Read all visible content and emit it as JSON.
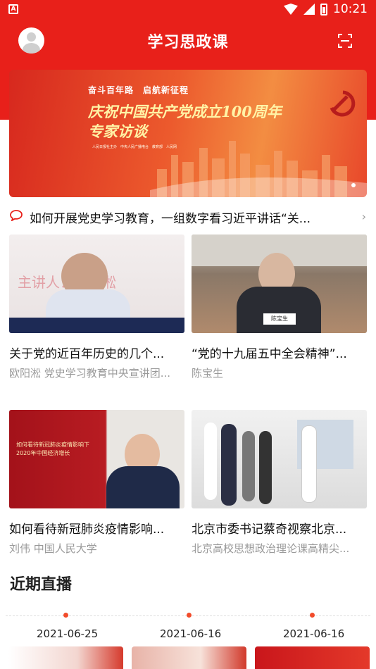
{
  "status": {
    "time": "10:21",
    "app_badge": "A"
  },
  "header": {
    "title": "学习思政课"
  },
  "banner": {
    "subtitle": "奋斗百年路　启航新征程",
    "title_line1": "庆祝中国共产党成立100周年",
    "title_line2": "专家访谈",
    "fine_print": "人民日报社主办　中央人民广播电台　教育部　人民网"
  },
  "news": {
    "text": "如何开展党史学习教育，一组数字看习近平讲话“关..."
  },
  "cards": [
    {
      "title": "关于党的近百年历史的几个...",
      "subtitle": "欧阳淞 党史学习教育中央宣讲团...",
      "img_caption": "主讲人：欧阳淞"
    },
    {
      "title": "“党的十九届五中全会精神”...",
      "subtitle": "陈宝生",
      "img_caption": "陈宝生"
    },
    {
      "title": "如何看待新冠肺炎疫情影响...",
      "subtitle": "刘伟  中国人民大学",
      "img_caption": "如何看待新冠肺炎疫情影响下 2020年中国经济增长"
    },
    {
      "title": "北京市委书记蔡奇视察北京...",
      "subtitle": "北京高校思想政治理论课高精尖...",
      "img_caption": ""
    }
  ],
  "live": {
    "section_title": "近期直播",
    "dates": [
      "2021-06-25",
      "2021-06-16",
      "2021-06-16"
    ]
  },
  "colors": {
    "brand_red": "#e8201a",
    "muted": "#999999"
  }
}
